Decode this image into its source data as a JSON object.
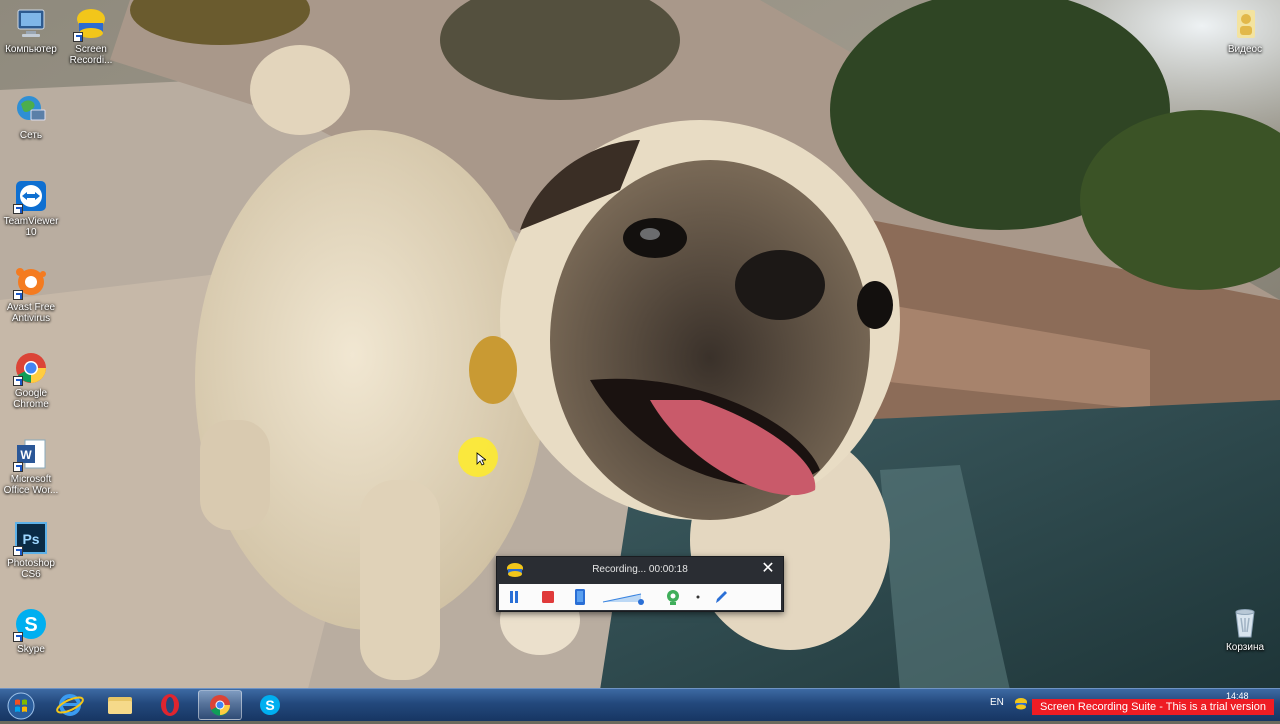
{
  "desktop": {
    "icons": [
      {
        "label": "Компьютер",
        "icon": "computer-icon"
      },
      {
        "label": "Screen Recordi...",
        "icon": "screen-recording-suite-icon"
      },
      {
        "label": "Сеть",
        "icon": "network-icon"
      },
      {
        "label": "TeamViewer 10",
        "icon": "teamviewer-icon"
      },
      {
        "label": "Avast Free Antivirus",
        "icon": "avast-icon"
      },
      {
        "label": "Google Chrome",
        "icon": "chrome-icon"
      },
      {
        "label": "Microsoft Office Wor...",
        "icon": "word-icon"
      },
      {
        "label": "Photoshop CS6",
        "icon": "photoshop-icon"
      },
      {
        "label": "Skype",
        "icon": "skype-icon"
      },
      {
        "label": "Видеос",
        "icon": "user-folder-icon"
      },
      {
        "label": "Корзина",
        "icon": "recycle-bin-icon"
      }
    ]
  },
  "recorder": {
    "status": "Recording... 00:00:18",
    "close_glyph": "✕",
    "buttons": [
      "pause-icon",
      "stop-icon",
      "device-icon",
      "volume-slider-icon",
      "webcam-icon",
      "dot-icon",
      "pen-icon"
    ]
  },
  "taskbar": {
    "start": "windows-orb-icon",
    "pinned": [
      "internet-explorer-icon",
      "explorer-folder-icon",
      "opera-icon",
      "chrome-icon",
      "skype-icon"
    ],
    "active_item": "chrome-icon",
    "language": "EN",
    "clock": "14:48",
    "trial_banner": "Screen Recording Suite - This is a trial version"
  },
  "colors": {
    "taskbar": "#23487c",
    "trial_banner": "#ee1c24",
    "recorder_bg": "#2a2d33",
    "cursor_highlight": "#ffec28"
  }
}
